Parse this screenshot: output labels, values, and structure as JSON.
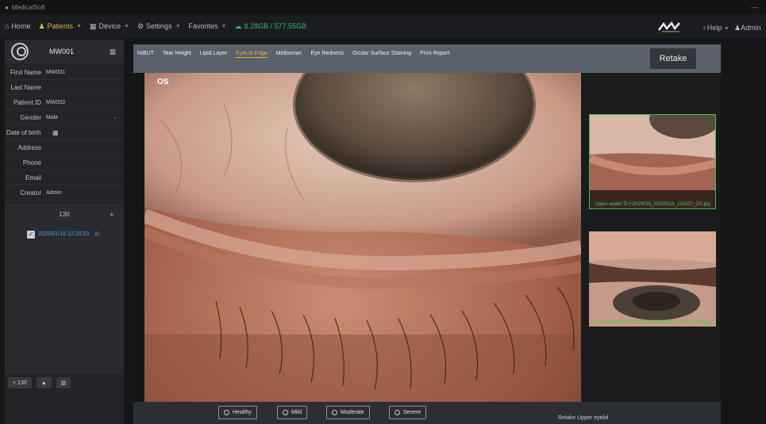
{
  "titlebar": {
    "app_name": "MedicalSoft",
    "minimize": "—"
  },
  "menubar": {
    "items": [
      {
        "label": "Home",
        "icon": "home-icon"
      },
      {
        "label": "Patients",
        "icon": "patients-icon",
        "active": true
      },
      {
        "label": "Device",
        "icon": "device-icon"
      },
      {
        "label": "Settings",
        "icon": "gear-icon"
      },
      {
        "label": "Favorites",
        "icon": ""
      }
    ],
    "disk": "8.28GB / 577.55GB",
    "help": "Help",
    "admin": "Admin"
  },
  "sidebar": {
    "patient_code": "MW001",
    "fields": [
      {
        "label": "First Name",
        "value": "MW001"
      },
      {
        "label": "Last Name",
        "value": ""
      },
      {
        "label": "Patient ID",
        "value": "MW002"
      },
      {
        "label": "Gender",
        "value": "Male"
      },
      {
        "label": "Date of birth",
        "value": ""
      },
      {
        "label": "Address",
        "value": ""
      },
      {
        "label": "Phone",
        "value": ""
      },
      {
        "label": "Email",
        "value": ""
      },
      {
        "label": "Creator",
        "value": "Admin"
      }
    ],
    "history_count": "130",
    "history_item": "2020/01/16 12:28:53",
    "buttons": [
      "+ 130",
      "▲",
      "▥"
    ]
  },
  "toolbar": {
    "tabs": [
      "NIBUT",
      "Tear Height",
      "Lipid Layer",
      "EyeLid Edge",
      "Meiboman",
      "Eye Redness",
      "Ocular Surface Staining",
      "Print Report"
    ],
    "active_tab": "EyeLid Edge",
    "retake": "Retake"
  },
  "main": {
    "eye_label": "OS"
  },
  "thumbnails": [
    {
      "caption": "Upper eyelid 王小2020016_20200116_124107_OS.jpg"
    },
    {
      "caption": "Lower eyelid 王小2020016_20200116_124131_OS.jpg"
    }
  ],
  "grading": {
    "options": [
      "Healthy",
      "Mild",
      "Moderate",
      "Severe"
    ],
    "retake_note": "Retake Upper eyelid"
  },
  "colors": {
    "accent": "#e0b340",
    "green": "#3ec965",
    "link": "#4a9be0"
  }
}
